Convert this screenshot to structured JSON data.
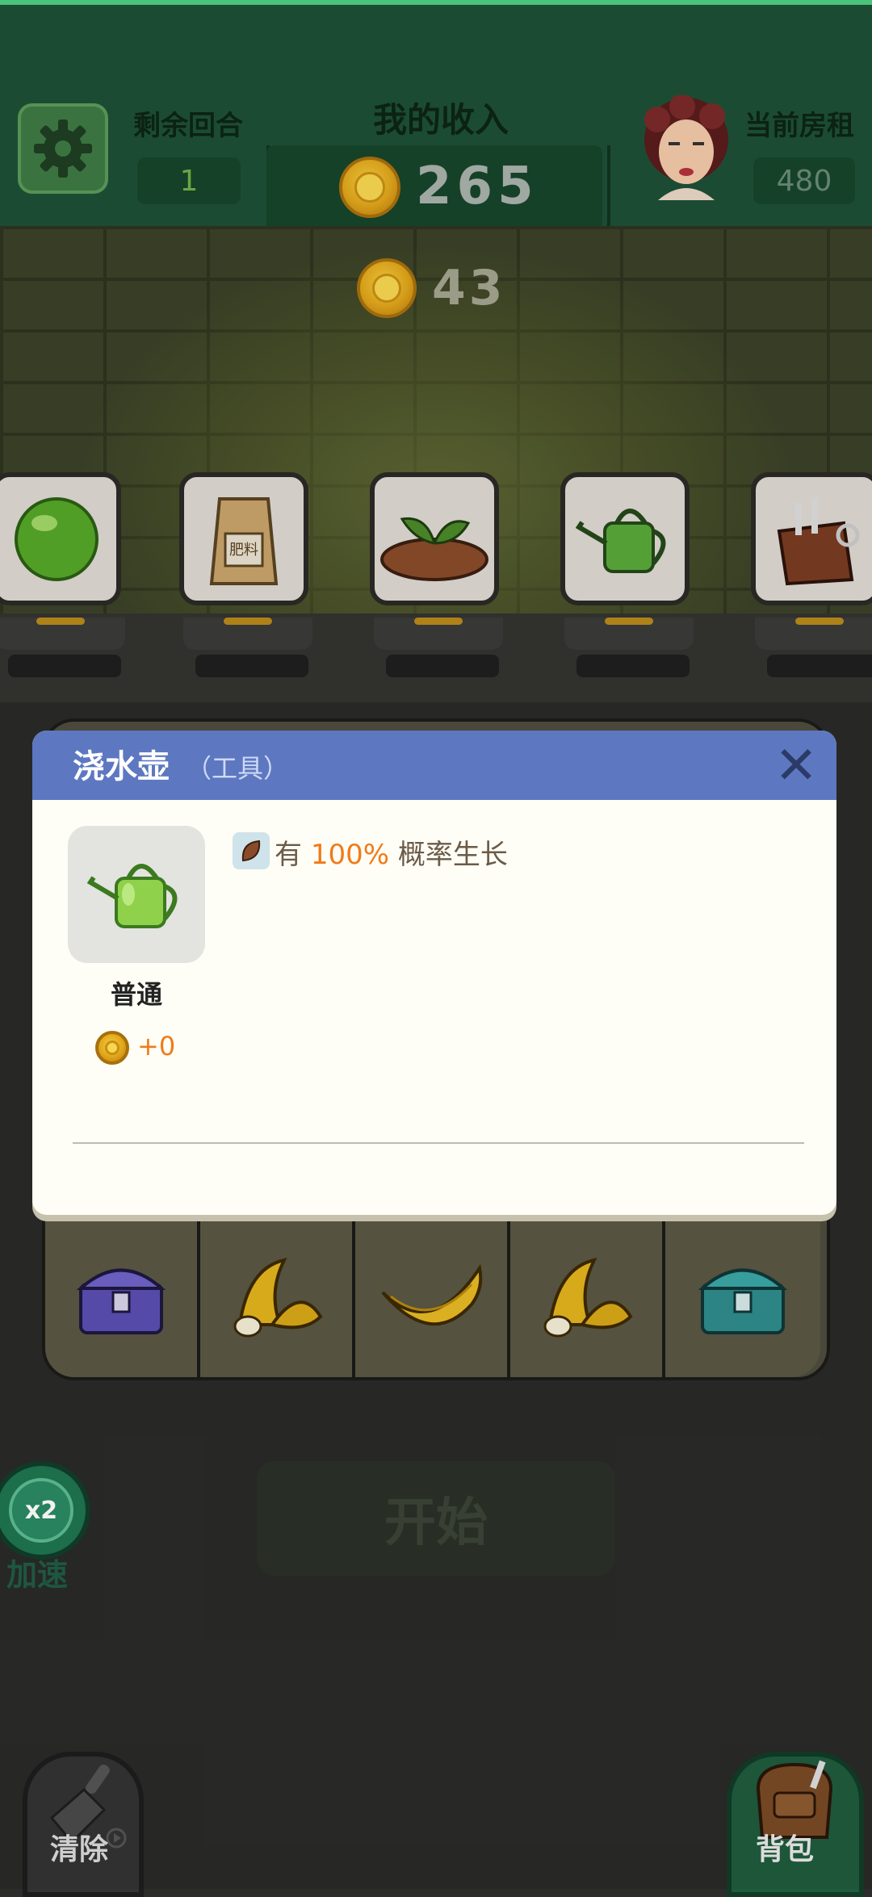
{
  "header": {
    "rounds_label": "剩余回合",
    "rounds_value": "1",
    "income_label": "我的收入",
    "income_value": "265",
    "rent_label": "当前房租",
    "rent_value": "480",
    "gain_value": "43"
  },
  "shelf": {
    "items": [
      {
        "name": "green-orb-icon"
      },
      {
        "name": "fertilizer-bag-icon",
        "text": "肥料"
      },
      {
        "name": "sprout-soil-icon"
      },
      {
        "name": "watering-can-icon"
      },
      {
        "name": "toolbag-icon"
      }
    ]
  },
  "modal": {
    "title": "浇水壶",
    "subtitle": "（工具）",
    "close_icon": "close-icon",
    "rarity": "普通",
    "price": "+0",
    "effect_prefix": "有",
    "effect_percent": "100%",
    "effect_suffix": "概率生长"
  },
  "grid_bottom_row": [
    {
      "name": "purple-chest-icon"
    },
    {
      "name": "peeled-banana-icon"
    },
    {
      "name": "banana-icon"
    },
    {
      "name": "peeled-banana-icon"
    },
    {
      "name": "teal-chest-icon"
    }
  ],
  "controls": {
    "speed_badge": "x2",
    "speed_label": "加速",
    "start_label": "开始",
    "clear_label": "清除",
    "bag_label": "背包"
  },
  "colors": {
    "top_bar": "#1d5136",
    "modal_header": "#5d78c1",
    "highlight": "#f07b18"
  }
}
